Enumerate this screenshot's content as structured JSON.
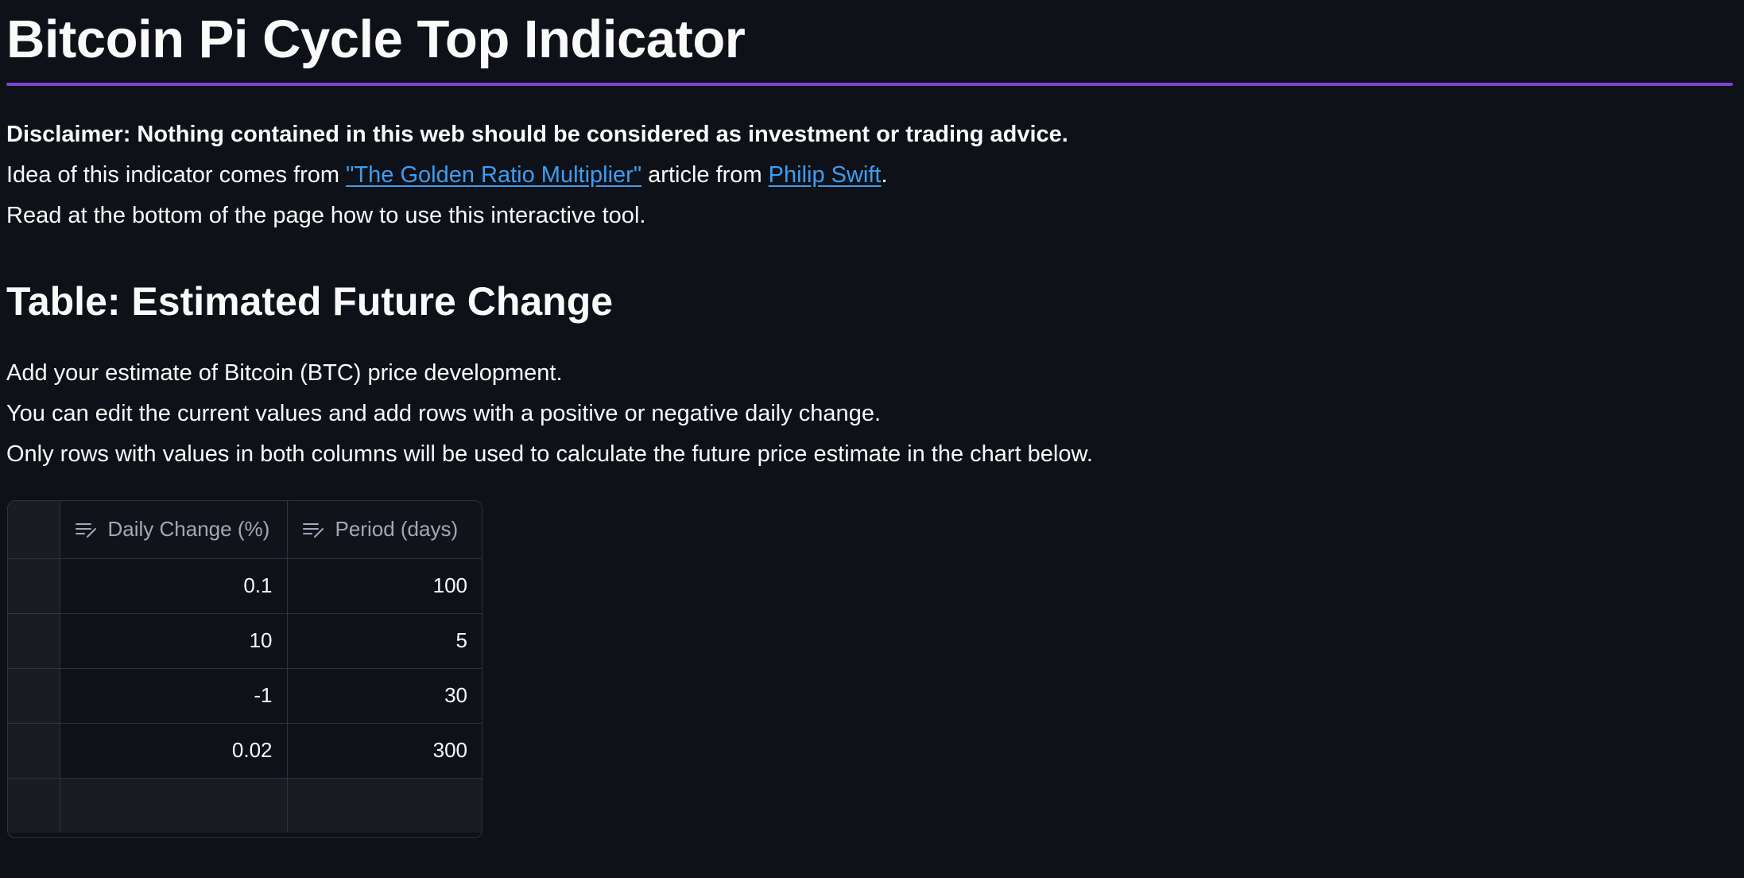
{
  "title": "Bitcoin Pi Cycle Top Indicator",
  "intro": {
    "disclaimer": "Disclaimer: Nothing contained in this web should be considered as investment or trading advice.",
    "idea_prefix": "Idea of this indicator comes from ",
    "article_link": "\"The Golden Ratio Multiplier\"",
    "idea_middle": " article from ",
    "author_link": "Philip Swift",
    "idea_suffix": ".",
    "read_note": "Read at the bottom of the page how to use this interactive tool."
  },
  "section": {
    "heading": "Table: Estimated Future Change",
    "lines": [
      "Add your estimate of Bitcoin (BTC) price development.",
      "You can edit the current values and add rows with a positive or negative daily change.",
      "Only rows with values in both columns will be used to calculate the future price estimate in the chart below."
    ]
  },
  "table": {
    "columns": [
      {
        "label": "Daily Change (%)",
        "icon": "edit-column-icon"
      },
      {
        "label": "Period (days)",
        "icon": "edit-column-icon"
      }
    ],
    "rows": [
      [
        "0.1",
        "100"
      ],
      [
        "10",
        "5"
      ],
      [
        "-1",
        "30"
      ],
      [
        "0.02",
        "300"
      ]
    ]
  },
  "colors": {
    "background": "#0e1117",
    "accent_divider": "#7d44cf",
    "link": "#3d9df3",
    "text": "#fafafa"
  }
}
